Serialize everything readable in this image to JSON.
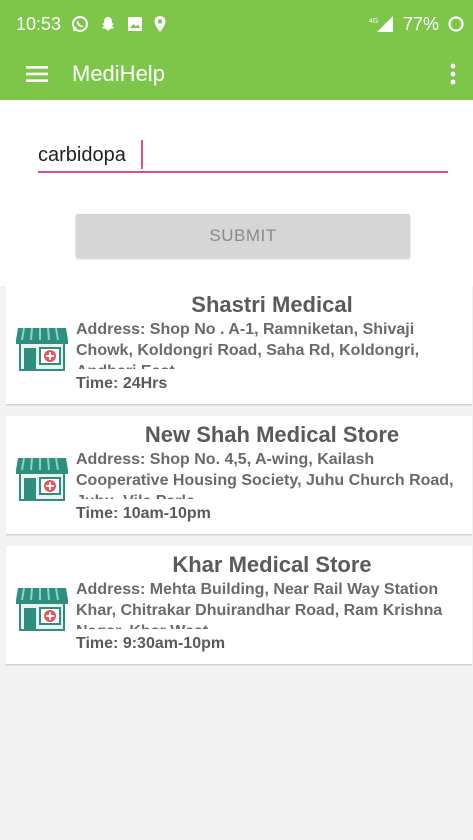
{
  "status_bar": {
    "time": "10:53",
    "battery": "77%",
    "network": "4G",
    "icons": [
      "whatsapp-icon",
      "snapchat-icon",
      "image-icon",
      "location-icon",
      "signal-icon",
      "sync-icon"
    ]
  },
  "app_bar": {
    "title": "MediHelp",
    "menu_icon": "hamburger-menu-icon",
    "overflow_icon": "more-vert-icon"
  },
  "search": {
    "value": "carbidopa",
    "submit_label": "SUBMIT"
  },
  "results": [
    {
      "name": "Shastri Medical",
      "address": "Address: Shop No . A-1, Ramniketan, Shivaji Chowk, Koldongri Road, Saha Rd, Koldongri, Andheri East",
      "time": "Time: 24Hrs"
    },
    {
      "name": "New Shah Medical Store",
      "address": "Address: Shop No. 4,5, A-wing, Kailash Cooperative Housing Society, Juhu Church Road, Juhu, Vile Parle",
      "time": "Time: 10am-10pm"
    },
    {
      "name": "Khar Medical Store",
      "address": "Address: Mehta Building, Near Rail Way Station Khar, Chitrakar Dhuirandhar Road, Ram Krishna Nagar, Khar West",
      "time": "Time: 9:30am-10pm"
    }
  ],
  "colors": {
    "primary": "#7dc64a",
    "accent": "#e44c7d",
    "store_awning": "#2f8f7f",
    "store_cross": "#e8545a"
  }
}
